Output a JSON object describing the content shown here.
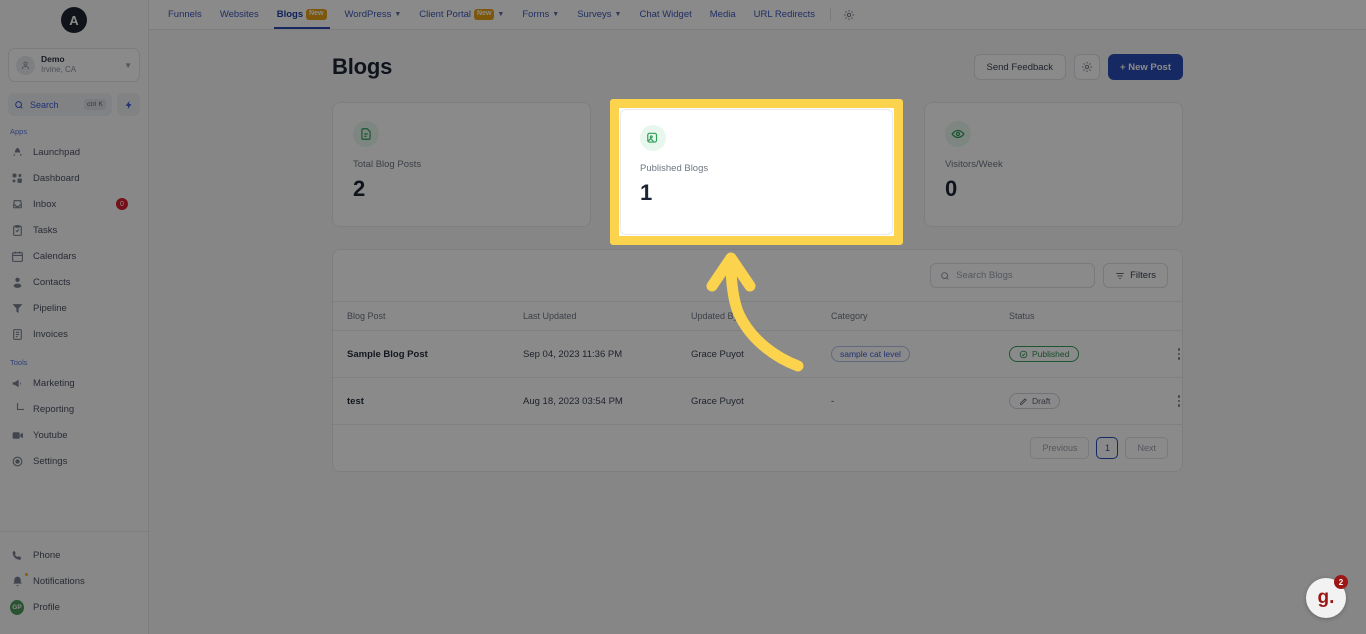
{
  "sidebar": {
    "logo_text": "A",
    "org": {
      "name": "Demo",
      "location": "Irvine, CA"
    },
    "search": {
      "placeholder": "Search",
      "shortcut": "ctrl K"
    },
    "sections": [
      {
        "title": "Apps",
        "items": [
          {
            "label": "Launchpad",
            "icon": "rocket-icon",
            "badge": ""
          },
          {
            "label": "Dashboard",
            "icon": "grid-icon",
            "badge": ""
          },
          {
            "label": "Inbox",
            "icon": "inbox-icon",
            "badge": "0"
          },
          {
            "label": "Tasks",
            "icon": "clipboard-icon",
            "badge": ""
          },
          {
            "label": "Calendars",
            "icon": "calendar-icon",
            "badge": ""
          },
          {
            "label": "Contacts",
            "icon": "user-icon",
            "badge": ""
          },
          {
            "label": "Pipeline",
            "icon": "funnel-icon",
            "badge": ""
          },
          {
            "label": "Invoices",
            "icon": "invoice-icon",
            "badge": ""
          }
        ]
      },
      {
        "title": "Tools",
        "items": [
          {
            "label": "Marketing",
            "icon": "megaphone-icon",
            "badge": ""
          },
          {
            "label": "Reporting",
            "icon": "pie-chart-icon",
            "badge": ""
          },
          {
            "label": "Youtube",
            "icon": "video-icon",
            "badge": ""
          },
          {
            "label": "Settings",
            "icon": "gear-icon",
            "badge": ""
          }
        ]
      }
    ],
    "bottom_items": [
      {
        "label": "Phone",
        "icon": "phone-icon"
      },
      {
        "label": "Notifications",
        "icon": "bell-icon"
      },
      {
        "label": "Profile",
        "icon": "avatar-icon",
        "initials": "GP"
      }
    ]
  },
  "topnav": {
    "items": [
      {
        "label": "Funnels",
        "badge": "",
        "caret": false,
        "active": false
      },
      {
        "label": "Websites",
        "badge": "",
        "caret": false,
        "active": false
      },
      {
        "label": "Blogs",
        "badge": "New",
        "caret": false,
        "active": true
      },
      {
        "label": "WordPress",
        "badge": "",
        "caret": true,
        "active": false
      },
      {
        "label": "Client Portal",
        "badge": "New",
        "caret": true,
        "active": false
      },
      {
        "label": "Forms",
        "badge": "",
        "caret": true,
        "active": false
      },
      {
        "label": "Surveys",
        "badge": "",
        "caret": true,
        "active": false
      },
      {
        "label": "Chat Widget",
        "badge": "",
        "caret": false,
        "active": false
      },
      {
        "label": "Media",
        "badge": "",
        "caret": false,
        "active": false
      },
      {
        "label": "URL Redirects",
        "badge": "",
        "caret": false,
        "active": false
      }
    ],
    "settings_icon": "gear-icon"
  },
  "page": {
    "title": "Blogs",
    "actions": {
      "send_feedback": "Send Feedback",
      "settings_icon": "gear-icon",
      "new_post": "+ New Post"
    }
  },
  "stats": [
    {
      "label": "Total Blog Posts",
      "value": "2",
      "icon": "document-icon"
    },
    {
      "label": "Published Blogs",
      "value": "1",
      "icon": "image-check-icon"
    },
    {
      "label": "Visitors/Week",
      "value": "0",
      "icon": "eye-icon"
    }
  ],
  "table": {
    "search_placeholder": "Search Blogs",
    "filters_label": "Filters",
    "columns": [
      "Blog Post",
      "Last Updated",
      "Updated By",
      "Category",
      "Status",
      ""
    ],
    "rows": [
      {
        "blog_post": "Sample Blog Post",
        "last_updated": "Sep 04, 2023 11:36 PM",
        "updated_by": "Grace Puyot",
        "category": "sample cat level",
        "status": "Published",
        "status_type": "published"
      },
      {
        "blog_post": "test",
        "last_updated": "Aug 18, 2023 03:54 PM",
        "updated_by": "Grace Puyot",
        "category": "-",
        "status": "Draft",
        "status_type": "draft"
      }
    ],
    "pagination": {
      "previous": "Previous",
      "current_page": "1",
      "next": "Next"
    }
  },
  "help_widget": {
    "label": "g.",
    "badge": "2"
  },
  "annotation": {
    "highlight_target": "Published Blogs",
    "highlight_color": "#FCD34D",
    "arrow_color": "#FCD34D"
  }
}
